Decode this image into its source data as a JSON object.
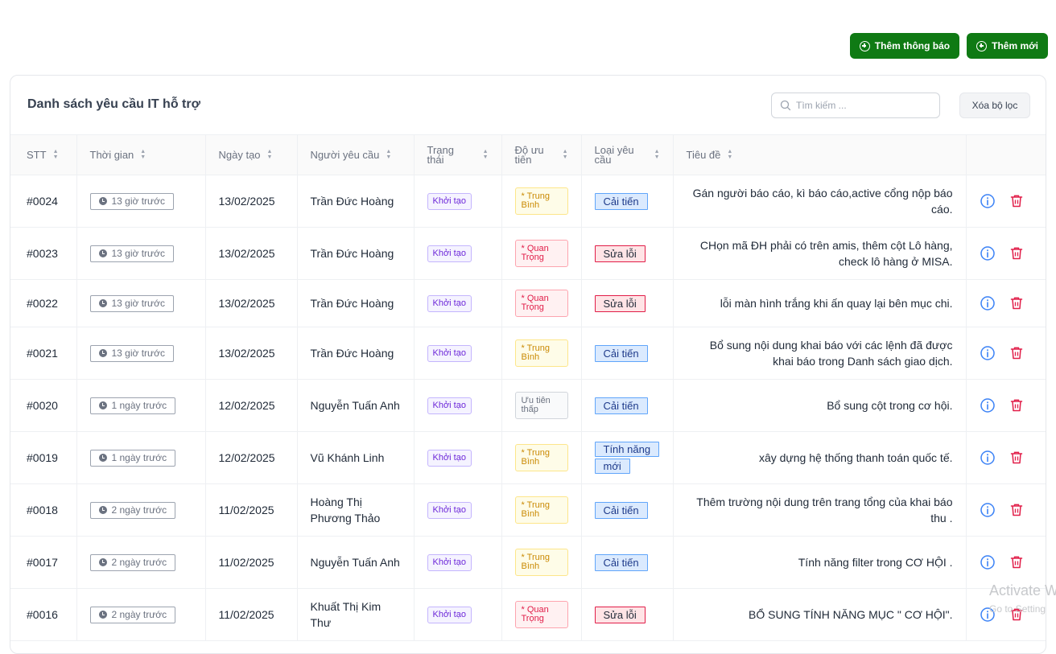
{
  "toolbar": {
    "add_notice_label": "Thêm thông báo",
    "add_new_label": "Thêm mới"
  },
  "card": {
    "title": "Danh sách yêu cầu IT hỗ trợ",
    "search_placeholder": "Tìm kiếm ...",
    "search_value": "",
    "clear_filter_label": "Xóa bộ lọc"
  },
  "columns": {
    "stt": "STT",
    "time": "Thời gian",
    "created": "Ngày tạo",
    "requester": "Người yêu cầu",
    "status": "Trạng thái",
    "priority": "Độ ưu tiên",
    "type": "Loại yêu cầu",
    "title": "Tiêu đề"
  },
  "rows": [
    {
      "id": "#0024",
      "time": "13 giờ trước",
      "date": "13/02/2025",
      "requester": "Trần Đức Hoàng",
      "status": "Khởi tạo",
      "priority": "* Trung Bình",
      "priority_level": "medium",
      "type": "Cải tiến",
      "type_kind": "improve",
      "title": "Gán người báo cáo, kì báo cáo,active cổng nộp báo cáo."
    },
    {
      "id": "#0023",
      "time": "13 giờ trước",
      "date": "13/02/2025",
      "requester": "Trần Đức Hoàng",
      "status": "Khởi tạo",
      "priority": "* Quan Trọng",
      "priority_level": "high",
      "type": "Sửa lỗi",
      "type_kind": "fix",
      "title": "CHọn mã ĐH phải có trên amis, thêm cột Lô hàng, check lô hàng ở MISA."
    },
    {
      "id": "#0022",
      "time": "13 giờ trước",
      "date": "13/02/2025",
      "requester": "Trần Đức Hoàng",
      "status": "Khởi tạo",
      "priority": "* Quan Trọng",
      "priority_level": "high",
      "type": "Sửa lỗi",
      "type_kind": "fix",
      "title": "lỗi màn hình trắng khi ấn quay lại bên mục chi."
    },
    {
      "id": "#0021",
      "time": "13 giờ trước",
      "date": "13/02/2025",
      "requester": "Trần Đức Hoàng",
      "status": "Khởi tạo",
      "priority": "* Trung Bình",
      "priority_level": "medium",
      "type": "Cải tiến",
      "type_kind": "improve",
      "title": "Bổ sung nội dung khai báo với các lệnh đã được khai báo trong Danh sách giao dịch."
    },
    {
      "id": "#0020",
      "time": "1 ngày trước",
      "date": "12/02/2025",
      "requester": "Nguyễn Tuấn Anh",
      "status": "Khởi tạo",
      "priority": "Ưu tiên thấp",
      "priority_level": "low",
      "type": "Cải tiến",
      "type_kind": "improve",
      "title": "Bổ sung cột trong cơ hội."
    },
    {
      "id": "#0019",
      "time": "1 ngày trước",
      "date": "12/02/2025",
      "requester": "Vũ Khánh Linh",
      "status": "Khởi tạo",
      "priority": "* Trung Bình",
      "priority_level": "medium",
      "type": "Tính năng mới",
      "type_kind": "feature",
      "title": "xây dựng hệ thống thanh toán quốc tế."
    },
    {
      "id": "#0018",
      "time": "2 ngày trước",
      "date": "11/02/2025",
      "requester": "Hoàng Thị Phương Thảo",
      "status": "Khởi tạo",
      "priority": "* Trung Bình",
      "priority_level": "medium",
      "type": "Cải tiến",
      "type_kind": "improve",
      "title": "Thêm trường nội dung trên trang tổng của khai báo thu ."
    },
    {
      "id": "#0017",
      "time": "2 ngày trước",
      "date": "11/02/2025",
      "requester": "Nguyễn Tuấn Anh",
      "status": "Khởi tạo",
      "priority": "* Trung Bình",
      "priority_level": "medium",
      "type": "Cải tiến",
      "type_kind": "improve",
      "title": "Tính năng filter trong CƠ HỘI ."
    },
    {
      "id": "#0016",
      "time": "2 ngày trước",
      "date": "11/02/2025",
      "requester": "Khuất Thị Kim Thư",
      "status": "Khởi tạo",
      "priority": "* Quan Trọng",
      "priority_level": "high",
      "type": "Sửa lỗi",
      "type_kind": "fix",
      "title": "BỔ SUNG TÍNH NĂNG MỤC \" CƠ HỘI\"."
    }
  ],
  "watermark": {
    "line1": "Activate W",
    "line2": "Go to Setting"
  },
  "icons": {
    "info": "info-circle-icon",
    "delete": "trash-icon",
    "clock": "clock-icon",
    "search": "search-icon",
    "add": "plus-circle-icon"
  },
  "colors": {
    "primary_button": "#0f7a14",
    "info_icon": "#3b82f6",
    "delete_icon": "#e11d48"
  }
}
